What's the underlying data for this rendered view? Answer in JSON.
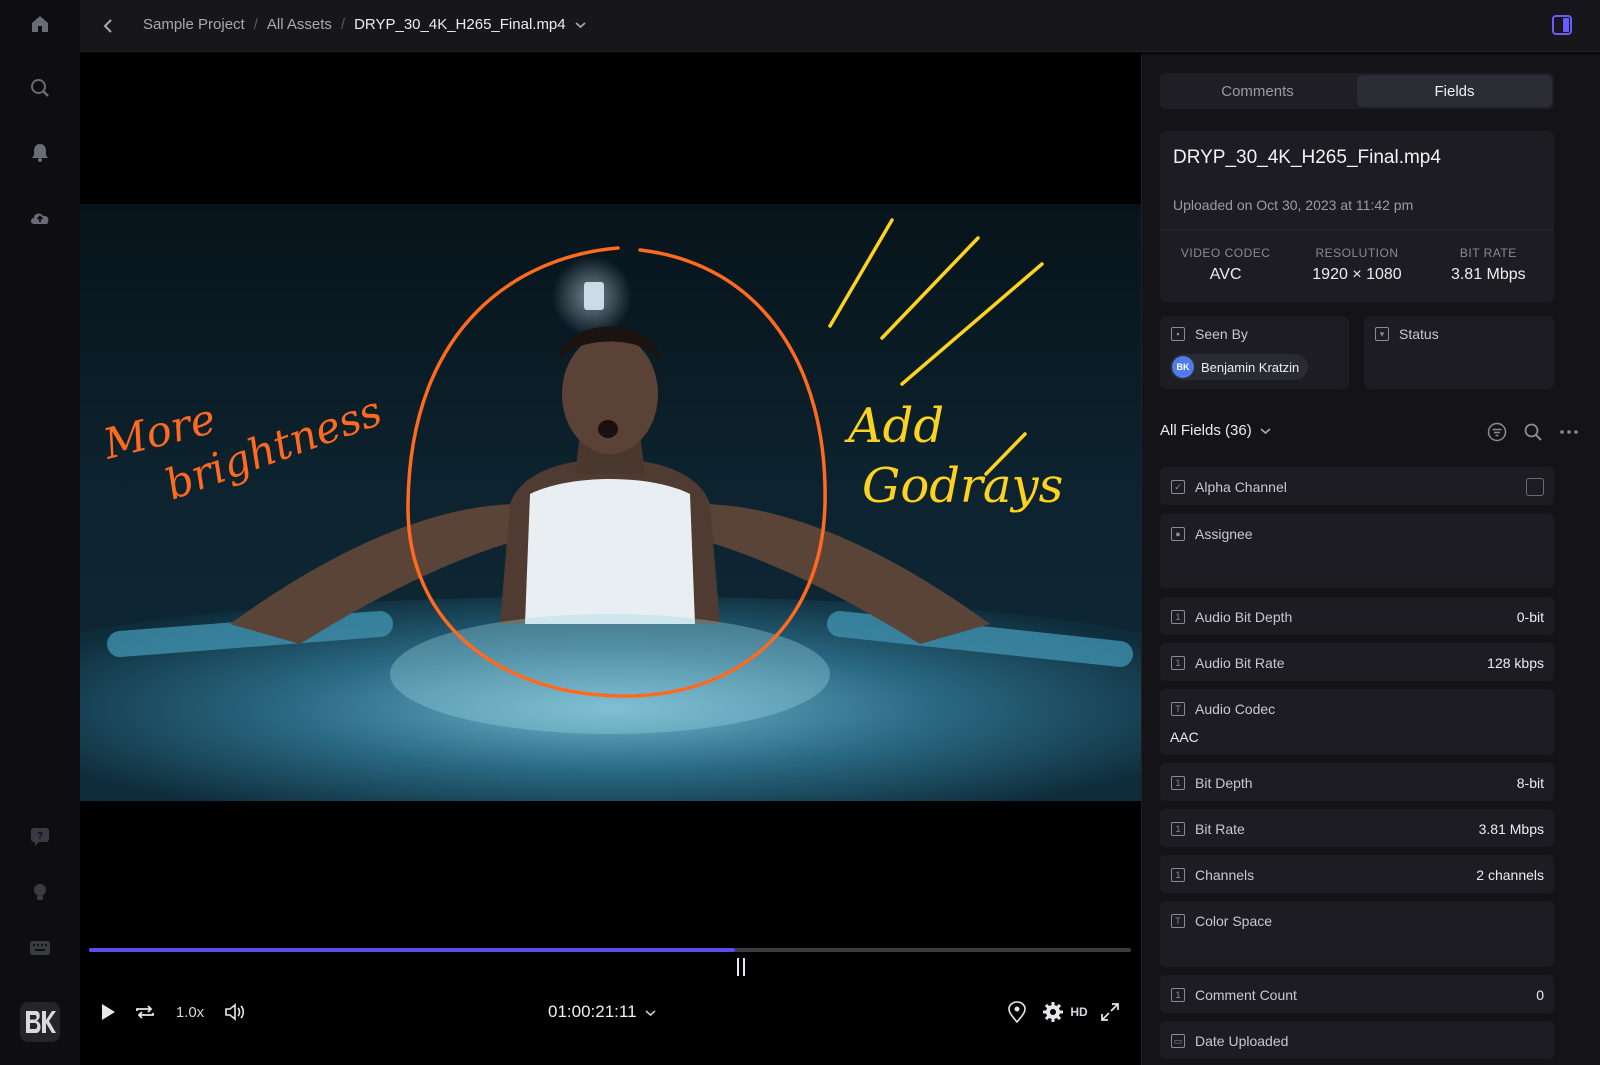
{
  "breadcrumb": {
    "project": "Sample Project",
    "folder": "All Assets",
    "file": "DRYP_30_4K_H265_Final.mp4"
  },
  "annotations": {
    "left": [
      "More",
      "brightness"
    ],
    "right": [
      "Add",
      "Godrays"
    ]
  },
  "player": {
    "speed": "1.0x",
    "timecode": "01:00:21:11",
    "quality": "HD",
    "progress": 0.62
  },
  "tabs": [
    "Comments",
    "Fields"
  ],
  "asset": {
    "name": "DRYP_30_4K_H265_Final.mp4",
    "uploaded": "Uploaded on Oct 30, 2023 at 11:42 pm",
    "video_codec_label": "VIDEO CODEC",
    "video_codec": "AVC",
    "resolution_label": "RESOLUTION",
    "resolution": "1920 × 1080",
    "bit_rate_label": "BIT RATE",
    "bit_rate": "3.81 Mbps"
  },
  "seen_by": {
    "label": "Seen By",
    "initials": "BK",
    "user": "Benjamin Kratzin"
  },
  "status": {
    "label": "Status"
  },
  "fields_header": "All Fields (36)",
  "fields": [
    {
      "label": "Alpha Channel",
      "value": ""
    },
    {
      "label": "Assignee",
      "value": ""
    },
    {
      "label": "Audio Bit Depth",
      "value": "0-bit"
    },
    {
      "label": "Audio Bit Rate",
      "value": "128 kbps"
    },
    {
      "label": "Audio Codec",
      "value": "AAC"
    },
    {
      "label": "Bit Depth",
      "value": "8-bit"
    },
    {
      "label": "Bit Rate",
      "value": "3.81 Mbps"
    },
    {
      "label": "Channels",
      "value": "2 channels"
    },
    {
      "label": "Color Space",
      "value": ""
    },
    {
      "label": "Comment Count",
      "value": "0"
    },
    {
      "label": "Date Uploaded",
      "value": ""
    }
  ],
  "colors": {
    "accent": "#5b4df0",
    "annotation_orange": "#ff6a1f",
    "annotation_yellow": "#ffd21f"
  }
}
